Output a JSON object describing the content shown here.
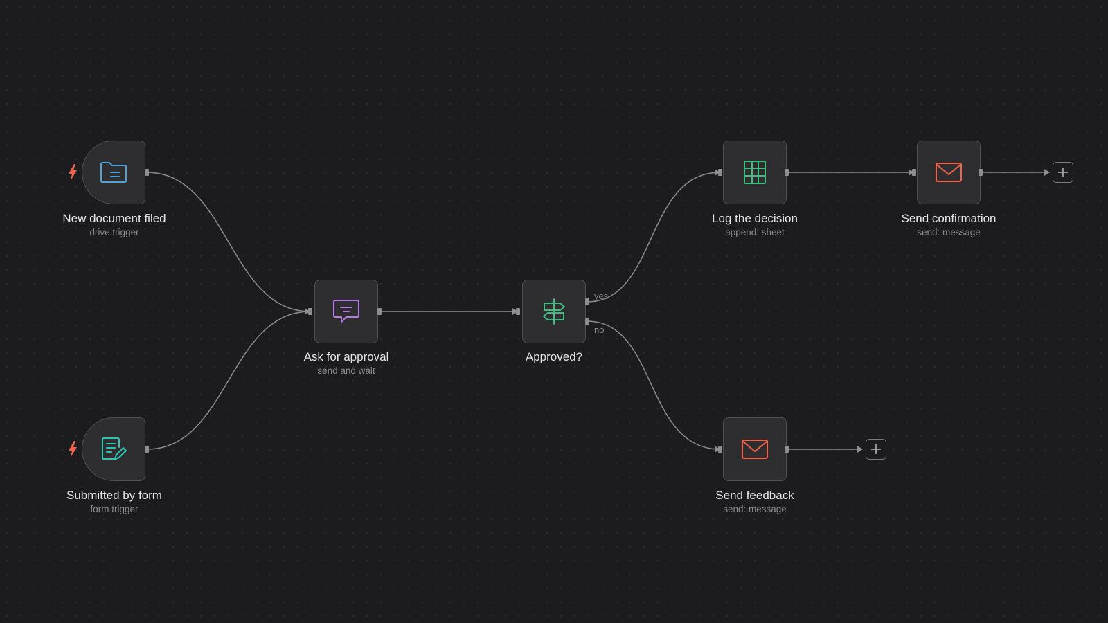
{
  "nodes": {
    "new_document": {
      "title": "New document filed",
      "subtitle": "drive trigger",
      "icon": "folder-document-icon",
      "color": "#4ea3dc"
    },
    "submitted_form": {
      "title": "Submitted by form",
      "subtitle": "form trigger",
      "icon": "form-edit-icon",
      "color": "#2ec4b6"
    },
    "ask_approval": {
      "title": "Ask for approval",
      "subtitle": "send and wait",
      "icon": "chat-bubble-icon",
      "color": "#b77be8"
    },
    "approved": {
      "title": "Approved?",
      "subtitle": "",
      "icon": "signpost-icon",
      "color": "#3fbf7f"
    },
    "log_decision": {
      "title": "Log the decision",
      "subtitle": "append: sheet",
      "icon": "spreadsheet-icon",
      "color": "#3fbf7f"
    },
    "send_confirmation": {
      "title": "Send confirmation",
      "subtitle": "send: message",
      "icon": "envelope-icon",
      "color": "#f0634a"
    },
    "send_feedback": {
      "title": "Send feedback",
      "subtitle": "send: message",
      "icon": "envelope-icon",
      "color": "#f0634a"
    }
  },
  "branches": {
    "yes": "yes",
    "no": "no"
  },
  "trigger_icon": {
    "name": "lightning-bolt-icon",
    "color": "#f0634a"
  },
  "colors": {
    "canvas": "#1c1c1e",
    "node_bg": "#2e2e31",
    "node_border": "#505055",
    "edge": "#8e8e92"
  }
}
